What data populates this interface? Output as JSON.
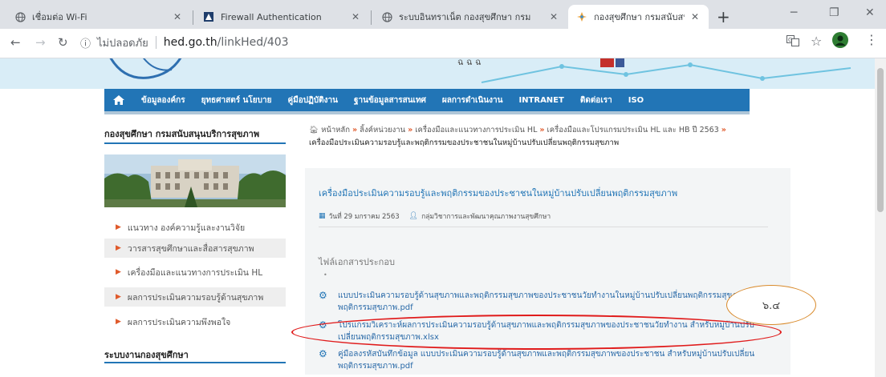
{
  "browser": {
    "tabs": [
      {
        "label": "เชื่อมต่อ Wi-Fi",
        "favicon": "globe-icon"
      },
      {
        "label": "Firewall Authentication",
        "favicon": "firewall-icon"
      },
      {
        "label": "ระบบอินทราเน็ต กองสุขศึกษา กรม",
        "favicon": "globe-icon"
      },
      {
        "label": "กองสุขศึกษา กรมสนับสนุนบริกา",
        "favicon": "thai-ministry-icon"
      }
    ],
    "new_tab": "+",
    "omnibox": {
      "security_label": "ไม่ปลอดภัย",
      "host": "hed.go.th",
      "path": "/linkHed/403"
    }
  },
  "site": {
    "nav": [
      "ข้อมูลองค์กร",
      "ยุทธศาสตร์ นโยบาย",
      "คู่มือปฏิบัติงาน",
      "ฐานข้อมูลสารสนเทศ",
      "ผลการดำเนินงาน",
      "INTRANET",
      "ติดต่อเรา",
      "ISO"
    ]
  },
  "sidebar": {
    "org_title": "กองสุขศึกษา กรมสนับสนุนบริการสุขภาพ",
    "links": [
      "แนวทาง องค์ความรู้และงานวิจัย",
      "วารสารสุขศึกษาและสื่อสารสุขภาพ",
      "เครื่องมือและแนวทางการประเมิน HL",
      "ผลการประเมินความรอบรู้ด้านสุขภาพ",
      "ผลการประเมินความพึงพอใจ"
    ],
    "system_title": "ระบบงานกองสุขศึกษา"
  },
  "breadcrumb": {
    "items": [
      "หน้าหลัก",
      "ลิ้งค์หน่วยงาน",
      "เครื่องมือและแนวทางการประเมิน HL",
      "เครื่องมือและโปรแกรมประเมิน HL และ HB ปี 2563"
    ],
    "current": "เครื่องมือประเมินความรอบรู้และพฤติกรรมของประชาชนในหมู่บ้านปรับเปลี่ยนพฤติกรรมสุขภาพ"
  },
  "article": {
    "title": "เครื่องมือประเมินความรอบรู้และพฤติกรรมของประชาชนในหมู่บ้านปรับเปลี่ยนพฤติกรรมสุขภาพ",
    "date": "วันที่ 29 มกราคม 2563",
    "author": "กลุ่มวิชาการและพัฒนาคุณภาพงานสุขศึกษา",
    "attachments_label": "ไฟล์เอกสารประกอบ",
    "attachments": [
      "แบบประเมินความรอบรู้ด้านสุขภาพและพฤติกรรมสุขภาพของประชาชนวัยทำงานในหมู่บ้านปรับเปลี่ยนพฤติกรรมสุขภาพพฤติกรรมสุขภาพ.pdf",
      "โปรแกรมวิเคราะห์ผลการประเมินความรอบรู้ด้านสุขภาพและพฤติกรรมสุขภาพของประชาชนวัยทำงาน สำหรับหมู่บ้านปรับเปลี่ยนพฤติกรรมสุขภาพ.xlsx",
      "คู่มือลงรหัสบันทึกข้อมูล แบบประเมินความรอบรู้ด้านสุขภาพและพฤติกรรมสุขภาพของประชาชน สำหรับหมู่บ้านปรับเปลี่ยนพฤติกรรมสุขภาพ.pdf"
    ]
  },
  "annotation": {
    "label": "๖.๔",
    "ellipse_color": "#e01b1b",
    "bubble_border": "#d98a2b"
  },
  "colors": {
    "primary_blue": "#2275b6",
    "arrow_orange": "#e05a2b",
    "header_bg": "#d9edf7"
  }
}
